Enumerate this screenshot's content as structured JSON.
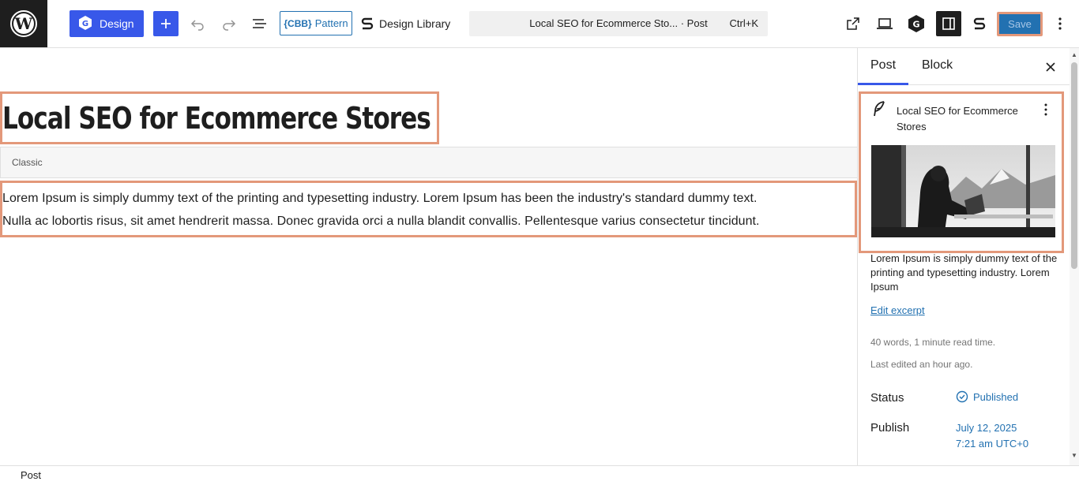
{
  "toolbar": {
    "design_label": "Design",
    "pattern_label": "Pattern",
    "pattern_badge": "{CBB}",
    "library_label": "Design Library",
    "command_title": "Local SEO for Ecommerce Sto... · Post",
    "command_shortcut": "Ctrl+K",
    "save_label": "Save"
  },
  "editor": {
    "post_title": "Local SEO for Ecommerce Stores",
    "classic_label": "Classic",
    "paragraph_line1": "Lorem Ipsum is simply dummy text of the printing and typesetting industry. Lorem Ipsum has been the industry's standard dummy text.",
    "paragraph_line2": "Nulla ac lobortis risus, sit amet hendrerit massa. Donec gravida orci a nulla blandit convallis. Pellentesque varius consectetur tincidunt."
  },
  "sidebar": {
    "tabs": [
      {
        "label": "Post",
        "active": true
      },
      {
        "label": "Block",
        "active": false
      }
    ],
    "card_title": "Local SEO for Ecommerce Stores",
    "excerpt": "Lorem Ipsum is simply dummy text of the printing and typesetting industry. Lorem Ipsum",
    "edit_excerpt_label": "Edit excerpt",
    "word_count": "40 words, 1 minute read time.",
    "last_edited": "Last edited an hour ago.",
    "status_label": "Status",
    "status_value": "Published",
    "publish_label": "Publish",
    "publish_date": "July 12, 2025",
    "publish_time": "7:21 am UTC+0"
  },
  "footer": {
    "breadcrumb": "Post"
  },
  "colors": {
    "accent": "#3858e9",
    "link": "#2271b1",
    "highlight": "#e3987a",
    "dark": "#1e1e1e"
  },
  "icons": [
    "wordpress-logo-icon",
    "g-logo-icon",
    "plus-icon",
    "undo-icon",
    "redo-icon",
    "list-view-icon",
    "stackable-icon",
    "external-link-icon",
    "desktop-preview-icon",
    "g-badge-icon",
    "sidebar-toggle-icon",
    "kebab-icon",
    "close-icon",
    "feather-icon",
    "check-circle-icon"
  ]
}
